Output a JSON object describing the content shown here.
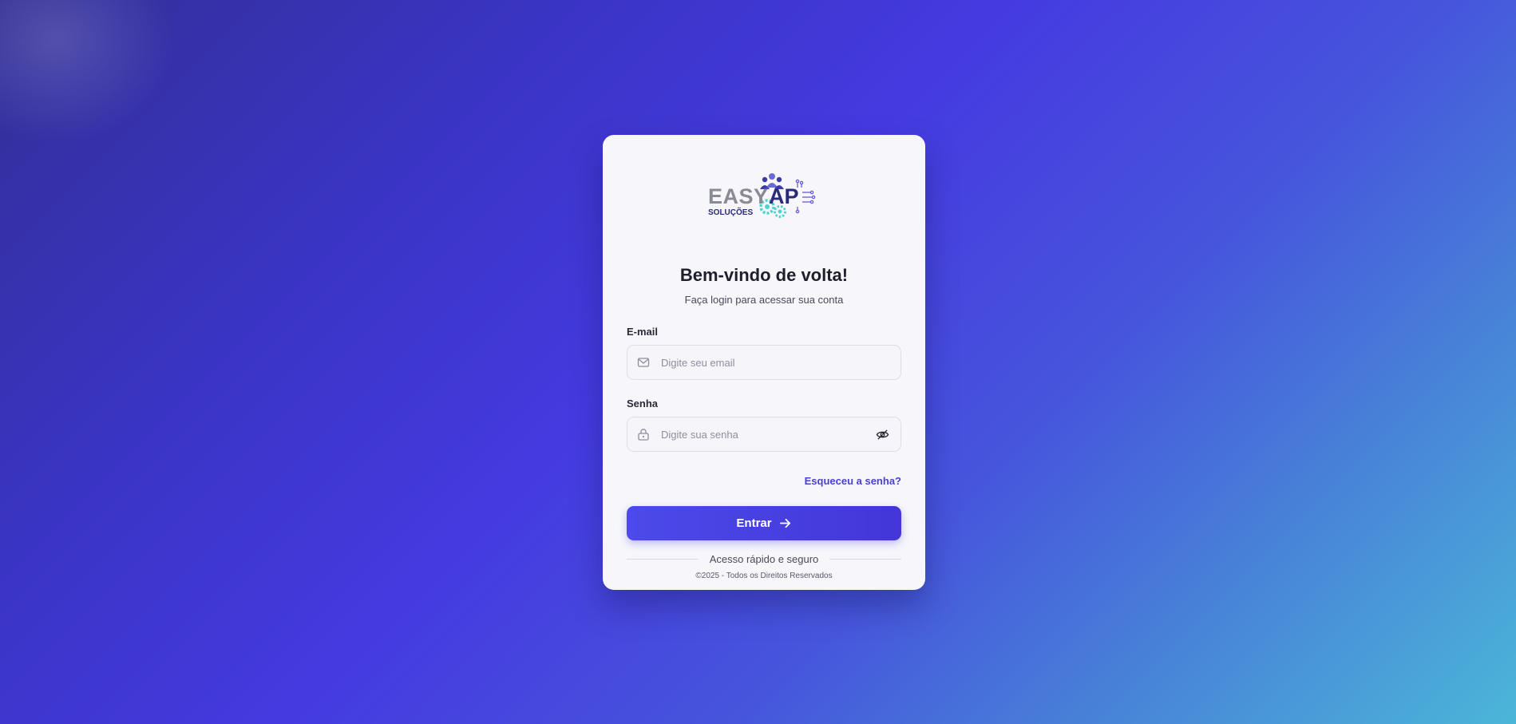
{
  "brand": {
    "logo_text_primary": "EASYAP",
    "logo_text_secondary": "SOLUÇÕES"
  },
  "login": {
    "title": "Bem-vindo de volta!",
    "subtitle": "Faça login para acessar sua conta",
    "email_label": "E-mail",
    "email_placeholder": "Digite seu email",
    "email_value": "",
    "password_label": "Senha",
    "password_placeholder": "Digite sua senha",
    "password_value": "",
    "forgot_link": "Esqueceu a senha?",
    "submit_label": "Entrar",
    "divider_text": "Acesso rápido e seguro",
    "copyright": "©2025 - Todos os Direitos Reservados"
  },
  "icons": {
    "email": "mail-icon",
    "password": "lock-icon",
    "toggle_visibility": "eye-off-icon",
    "submit": "arrow-right-icon"
  },
  "colors": {
    "accent": "#4a3fd6",
    "button_start": "#4c4aea",
    "button_end": "#4436d8",
    "logo_gray": "#8a8a94",
    "logo_navy": "#2b2a7a",
    "logo_teal": "#4fd3cf"
  }
}
